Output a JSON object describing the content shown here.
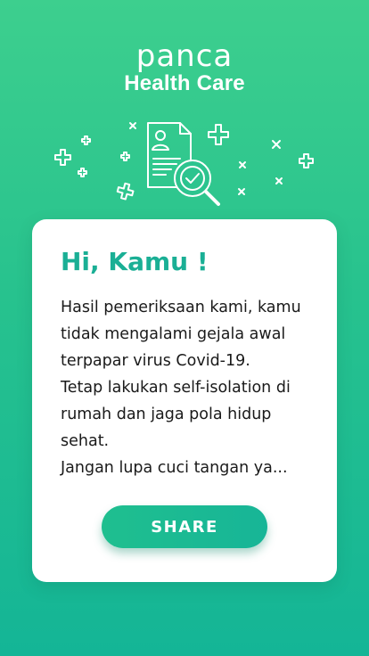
{
  "brand": {
    "logo_text": "panca",
    "subtitle": "Health Care"
  },
  "illustration": {
    "icon": "medical-report-check-icon",
    "color": "#ffffff"
  },
  "card": {
    "greeting": "Hi, Kamu !",
    "message_lines": [
      "Hasil pemeriksaan kami, kamu",
      "tidak mengalami gejala awal",
      "terpapar virus Covid-19.",
      "Tetap lakukan self-isolation di",
      "rumah dan jaga pola hidup",
      "sehat.",
      "Jangan lupa cuci tangan ya..."
    ],
    "share_label": "SHARE"
  },
  "colors": {
    "accent": "#1aaf95",
    "background_top": "#3dcf8e",
    "background_bottom": "#14b596"
  }
}
